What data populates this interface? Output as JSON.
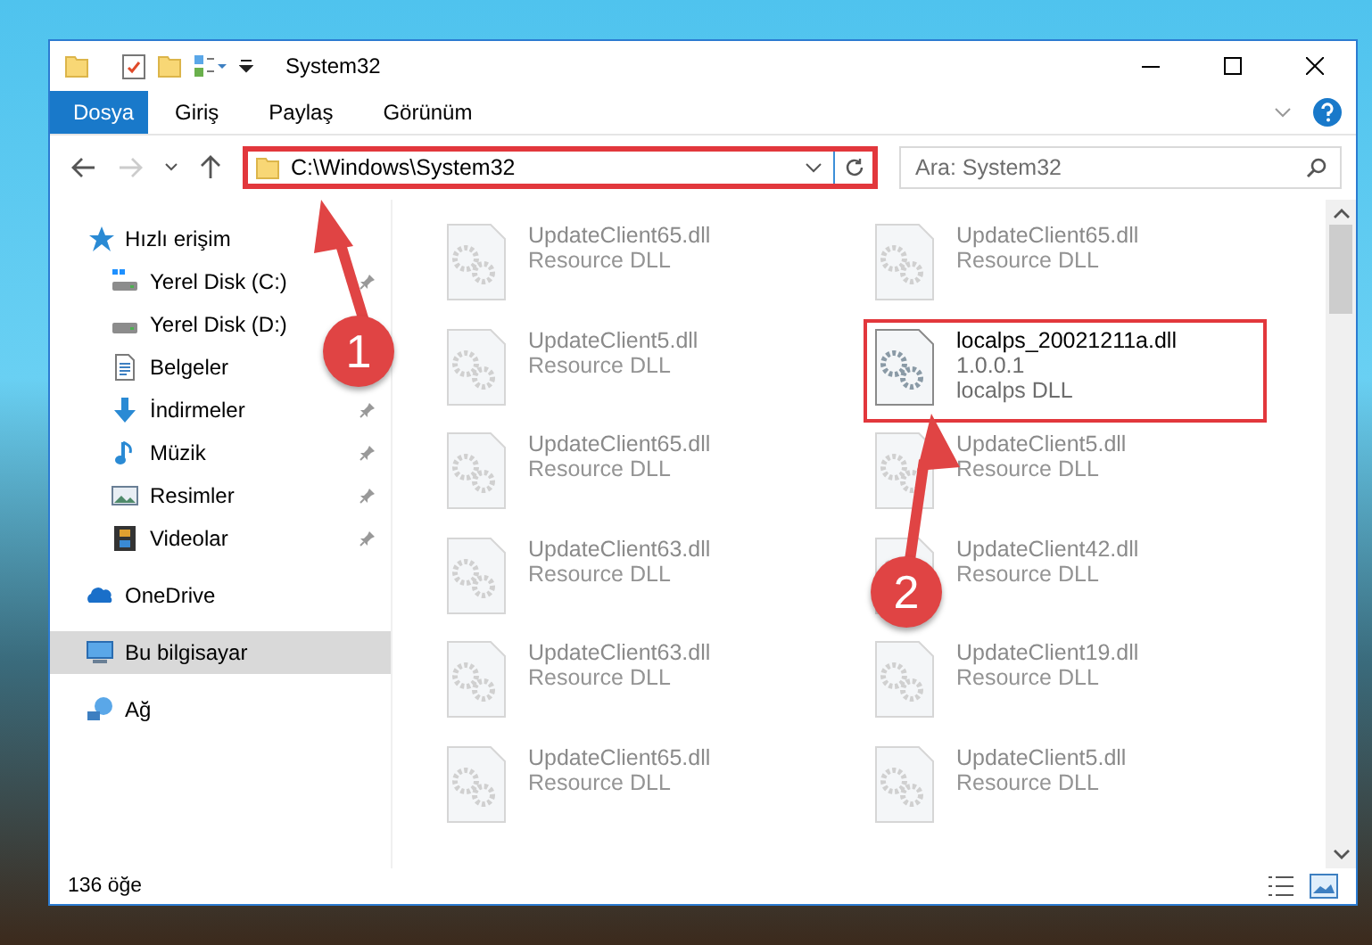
{
  "window": {
    "title": "System32"
  },
  "ribbon_tabs": [
    {
      "label": "Dosya",
      "selected": true
    },
    {
      "label": "Giriş",
      "selected": false
    },
    {
      "label": "Paylaş",
      "selected": false
    },
    {
      "label": "Görünüm",
      "selected": false
    }
  ],
  "address": {
    "path": "C:\\Windows\\System32",
    "highlighted": true
  },
  "search": {
    "placeholder": "Ara: System32"
  },
  "sidebar": {
    "items": [
      {
        "label": "Hızlı erişim",
        "kind": "star",
        "selected": false,
        "children": [
          {
            "label": "Yerel Disk (C:)",
            "kind": "drive-win",
            "pinned": true,
            "selected": false
          },
          {
            "label": "Yerel Disk (D:)",
            "kind": "drive",
            "pinned": false,
            "selected": false
          },
          {
            "label": "Belgeler",
            "kind": "docs",
            "pinned": false,
            "selected": false
          },
          {
            "label": "İndirmeler",
            "kind": "download",
            "pinned": true,
            "selected": false
          },
          {
            "label": "Müzik",
            "kind": "music",
            "pinned": true,
            "selected": false
          },
          {
            "label": "Resimler",
            "kind": "pictures",
            "pinned": true,
            "selected": false
          },
          {
            "label": "Videolar",
            "kind": "videos",
            "pinned": true,
            "selected": false
          }
        ]
      },
      {
        "label": "OneDrive",
        "kind": "cloud",
        "selected": false
      },
      {
        "label": "Bu bilgisayar",
        "kind": "pc",
        "selected": true
      },
      {
        "label": "Ağ",
        "kind": "network",
        "selected": false
      }
    ]
  },
  "files": [
    {
      "name": "UpdateClient65.dll",
      "lines": [
        "Resource DLL"
      ],
      "highlighted": false
    },
    {
      "name": "UpdateClient65.dll",
      "lines": [
        "Resource DLL"
      ],
      "highlighted": false
    },
    {
      "name": "UpdateClient5.dll",
      "lines": [
        "Resource DLL"
      ],
      "highlighted": false
    },
    {
      "name": "localps_20021211a.dll",
      "lines": [
        "1.0.0.1",
        "localps DLL"
      ],
      "highlighted": true
    },
    {
      "name": "UpdateClient65.dll",
      "lines": [
        "Resource DLL"
      ],
      "highlighted": false
    },
    {
      "name": "UpdateClient5.dll",
      "lines": [
        "Resource DLL"
      ],
      "highlighted": false
    },
    {
      "name": "UpdateClient63.dll",
      "lines": [
        "Resource DLL"
      ],
      "highlighted": false
    },
    {
      "name": "UpdateClient42.dll",
      "lines": [
        "Resource DLL"
      ],
      "highlighted": false
    },
    {
      "name": "UpdateClient63.dll",
      "lines": [
        "Resource DLL"
      ],
      "highlighted": false
    },
    {
      "name": "UpdateClient19.dll",
      "lines": [
        "Resource DLL"
      ],
      "highlighted": false
    },
    {
      "name": "UpdateClient65.dll",
      "lines": [
        "Resource DLL"
      ],
      "highlighted": false
    },
    {
      "name": "UpdateClient5.dll",
      "lines": [
        "Resource DLL"
      ],
      "highlighted": false
    }
  ],
  "status_bar": {
    "item_count": "136 öğe"
  },
  "annotations": [
    {
      "label": "1"
    },
    {
      "label": "2"
    }
  ]
}
